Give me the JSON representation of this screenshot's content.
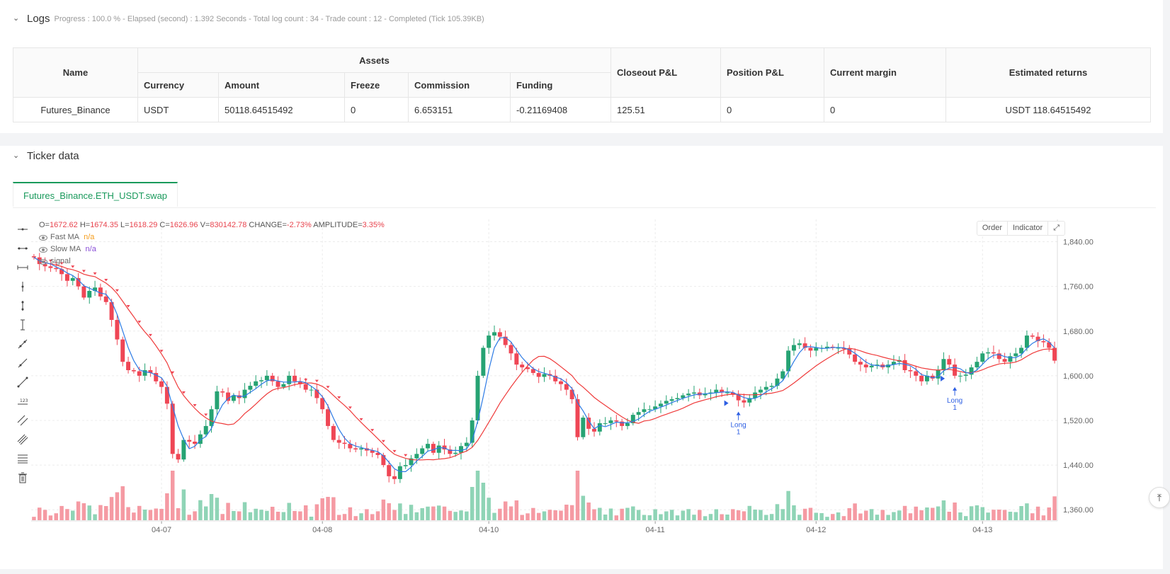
{
  "logs": {
    "title": "Logs",
    "meta": "Progress : 100.0 % - Elapsed (second) : 1.392  Seconds - Total log count : 34 - Trade count : 12 - Completed (Tick 105.39KB)",
    "table": {
      "headers": {
        "name": "Name",
        "assets": "Assets",
        "currency": "Currency",
        "amount": "Amount",
        "freeze": "Freeze",
        "commission": "Commission",
        "funding": "Funding",
        "closeout_pl": "Closeout P&L",
        "position_pl": "Position P&L",
        "current_margin": "Current margin",
        "estimated_returns": "Estimated returns"
      },
      "row": {
        "name": "Futures_Binance",
        "currency": "USDT",
        "amount": "50118.64515492",
        "freeze": "0",
        "commission": "6.653151",
        "funding": "-0.21169408",
        "closeout_pl": "125.51",
        "position_pl": "0",
        "current_margin": "0",
        "estimated_returns": "USDT 118.64515492"
      }
    }
  },
  "ticker": {
    "title": "Ticker data",
    "tab": "Futures_Binance.ETH_USDT.swap",
    "buttons": {
      "order": "Order",
      "indicator": "Indicator"
    },
    "legend": {
      "o_label": "O=",
      "o": "1672.62",
      "h_label": "H=",
      "h": "1674.35",
      "l_label": "L=",
      "l": "1618.29",
      "c_label": "C=",
      "c": "1626.96",
      "v_label": "V=",
      "v": "830142.78",
      "change_label": "CHANGE=",
      "change": "-2.73%",
      "amp_label": "AMPLITUDE=",
      "amp": "3.35%",
      "fast_ma": "Fast MA",
      "fast_ma_val": "n/a",
      "slow_ma": "Slow MA",
      "slow_ma_val": "n/a",
      "signal": "signal"
    },
    "tools": [
      "cursor-icon",
      "horizontal-line-icon",
      "horizontal-ray-icon",
      "vertical-line-icon",
      "vertical-segment-icon",
      "vertical-ray-icon",
      "trend-line-icon",
      "ray-line-icon",
      "extended-line-icon",
      "price-label-icon",
      "parallel-channel-icon",
      "pitchfork-icon",
      "fib-retracement-icon",
      "trash-icon"
    ]
  },
  "colors": {
    "up": "#26a373",
    "down": "#ef4655",
    "fast_ma": "#2d7be5",
    "slow_ma": "#ef3b3b",
    "signal": "#2d5fe3",
    "tab_accent": "#1a9a5c"
  },
  "chart_data": {
    "type": "candlestick",
    "symbol": "Futures_Binance.ETH_USDT.swap",
    "ylim": [
      1340,
      1880
    ],
    "y_ticks": [
      "1,840.00",
      "1,760.00",
      "1,680.00",
      "1,600.00",
      "1,520.00",
      "1,440.00",
      "1,360.00"
    ],
    "x_ticks": [
      "04-07",
      "04-08",
      "04-10",
      "04-11",
      "04-12",
      "04-13"
    ],
    "closes": [
      1812,
      1800,
      1796,
      1793,
      1791,
      1782,
      1770,
      1775,
      1760,
      1740,
      1752,
      1758,
      1742,
      1732,
      1700,
      1665,
      1625,
      1610,
      1608,
      1600,
      1610,
      1605,
      1590,
      1580,
      1550,
      1460,
      1450,
      1485,
      1482,
      1478,
      1495,
      1510,
      1540,
      1572,
      1570,
      1555,
      1565,
      1560,
      1575,
      1582,
      1590,
      1592,
      1600,
      1590,
      1580,
      1585,
      1600,
      1590,
      1585,
      1575,
      1575,
      1560,
      1540,
      1510,
      1485,
      1480,
      1478,
      1470,
      1468,
      1470,
      1466,
      1462,
      1458,
      1440,
      1420,
      1415,
      1438,
      1440,
      1452,
      1460,
      1470,
      1478,
      1462,
      1475,
      1468,
      1460,
      1462,
      1474,
      1480,
      1520,
      1600,
      1650,
      1672,
      1678,
      1670,
      1655,
      1640,
      1620,
      1615,
      1612,
      1605,
      1598,
      1603,
      1600,
      1590,
      1585,
      1575,
      1558,
      1490,
      1525,
      1505,
      1500,
      1515,
      1515,
      1520,
      1518,
      1510,
      1515,
      1530,
      1535,
      1540,
      1540,
      1545,
      1550,
      1555,
      1558,
      1560,
      1565,
      1568,
      1570,
      1565,
      1568,
      1570,
      1575,
      1570,
      1570,
      1566,
      1556,
      1552,
      1560,
      1570,
      1575,
      1580,
      1582,
      1595,
      1608,
      1645,
      1655,
      1658,
      1650,
      1645,
      1650,
      1650,
      1652,
      1650,
      1650,
      1648,
      1638,
      1625,
      1620,
      1615,
      1618,
      1620,
      1615,
      1620,
      1625,
      1628,
      1610,
      1608,
      1600,
      1590,
      1600,
      1595,
      1610,
      1630,
      1620,
      1600,
      1600,
      1602,
      1615,
      1625,
      1640,
      1642,
      1640,
      1630,
      1625,
      1635,
      1640,
      1650,
      1672,
      1670,
      1662,
      1660,
      1650,
      1627
    ],
    "opens": [
      1814,
      1812,
      1800,
      1796,
      1793,
      1791,
      1782,
      1770,
      1775,
      1760,
      1740,
      1752,
      1758,
      1742,
      1732,
      1700,
      1665,
      1625,
      1610,
      1608,
      1600,
      1610,
      1605,
      1590,
      1580,
      1550,
      1460,
      1450,
      1485,
      1482,
      1478,
      1495,
      1510,
      1540,
      1572,
      1570,
      1555,
      1565,
      1560,
      1575,
      1582,
      1590,
      1592,
      1600,
      1590,
      1580,
      1585,
      1600,
      1590,
      1585,
      1575,
      1575,
      1560,
      1540,
      1510,
      1485,
      1480,
      1478,
      1470,
      1468,
      1470,
      1466,
      1462,
      1458,
      1440,
      1420,
      1415,
      1438,
      1440,
      1452,
      1460,
      1470,
      1478,
      1462,
      1475,
      1468,
      1460,
      1462,
      1474,
      1480,
      1520,
      1600,
      1650,
      1672,
      1678,
      1670,
      1655,
      1640,
      1620,
      1615,
      1612,
      1605,
      1598,
      1603,
      1600,
      1590,
      1585,
      1575,
      1558,
      1490,
      1525,
      1505,
      1500,
      1515,
      1515,
      1520,
      1518,
      1510,
      1515,
      1530,
      1535,
      1540,
      1540,
      1545,
      1550,
      1555,
      1558,
      1560,
      1565,
      1568,
      1570,
      1565,
      1568,
      1570,
      1575,
      1570,
      1570,
      1566,
      1556,
      1552,
      1560,
      1570,
      1575,
      1580,
      1582,
      1595,
      1608,
      1645,
      1655,
      1658,
      1650,
      1645,
      1650,
      1650,
      1652,
      1650,
      1650,
      1648,
      1638,
      1625,
      1620,
      1615,
      1618,
      1620,
      1615,
      1620,
      1625,
      1628,
      1610,
      1608,
      1600,
      1590,
      1600,
      1595,
      1610,
      1630,
      1620,
      1600,
      1600,
      1602,
      1615,
      1625,
      1640,
      1642,
      1640,
      1630,
      1625,
      1635,
      1640,
      1650,
      1672,
      1670,
      1662,
      1660,
      1650,
      1673
    ],
    "fast_ma_label": "Fast MA",
    "slow_ma_label": "Slow MA",
    "signal_label": "signal",
    "annotations": [
      {
        "label": "Long",
        "qty": "1",
        "bar": 127
      },
      {
        "label": "Long",
        "qty": "1",
        "bar": 166
      }
    ]
  }
}
